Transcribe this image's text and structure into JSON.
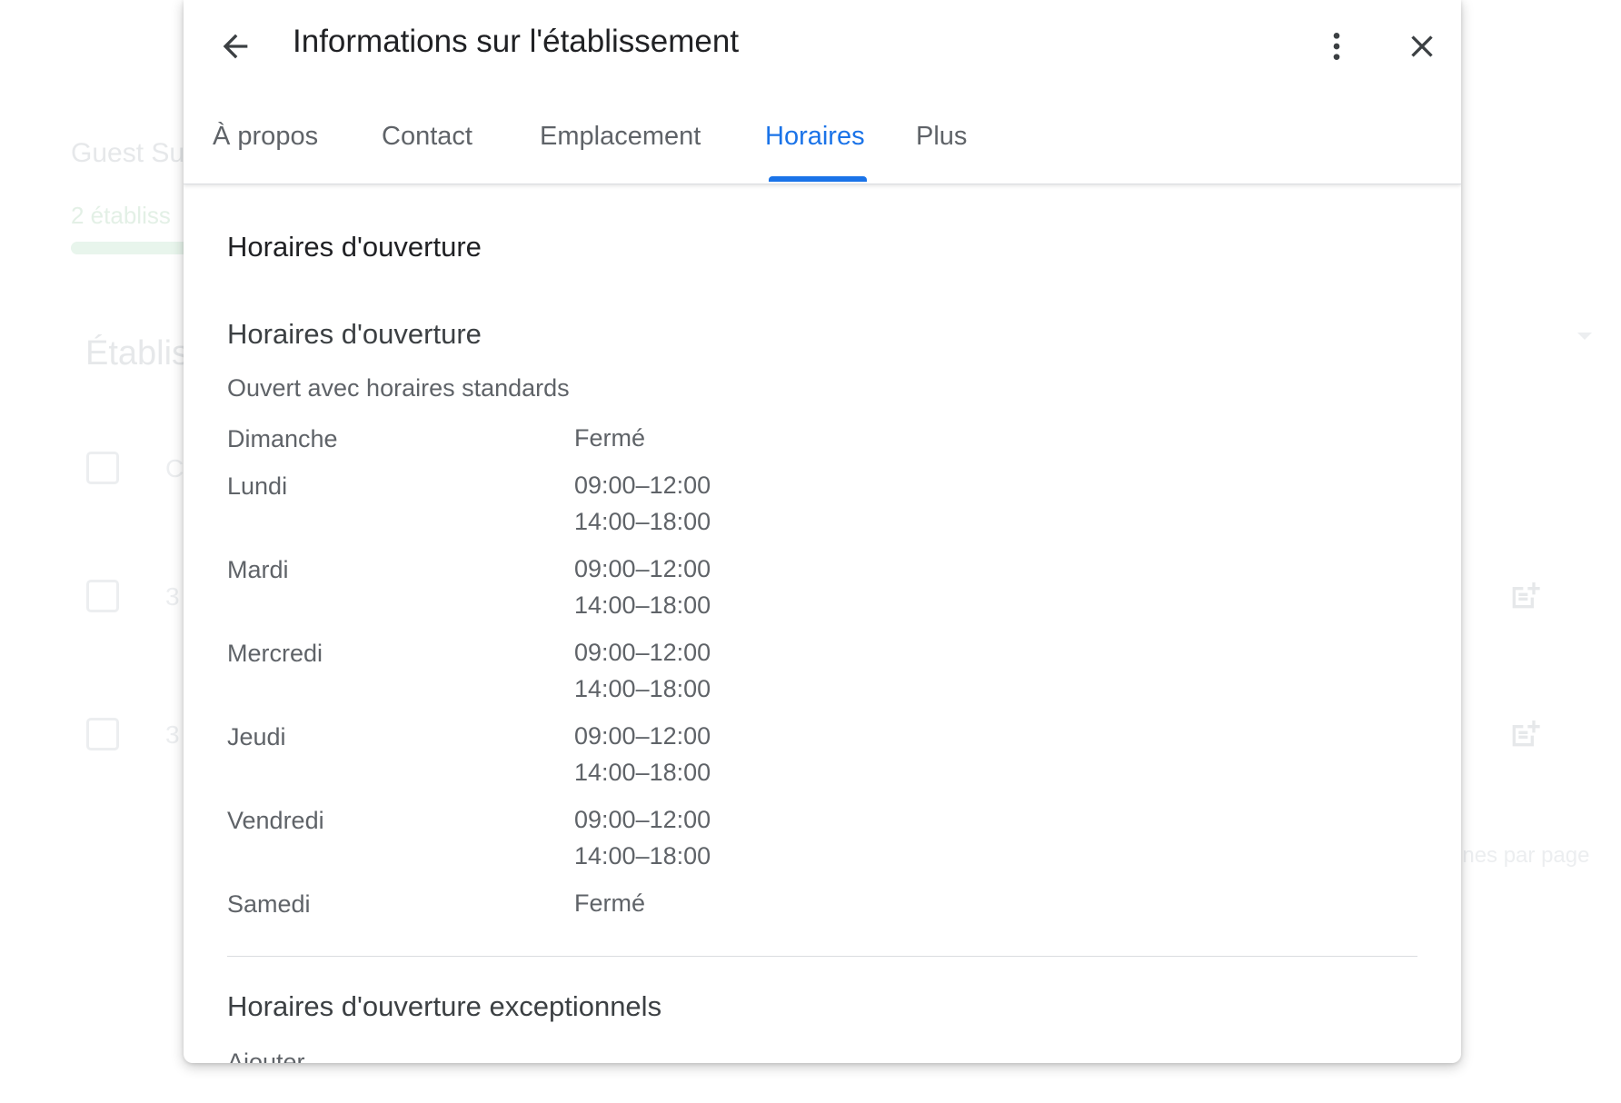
{
  "background": {
    "title": "Guest Su",
    "subtitle": "2 établiss",
    "heading": "Établis",
    "row_texts": [
      "C",
      "3",
      "3"
    ],
    "rows_per_page": "gnes par page"
  },
  "dialog": {
    "title": "Informations sur l'établissement",
    "tabs": [
      {
        "label": "À propos"
      },
      {
        "label": "Contact"
      },
      {
        "label": "Emplacement"
      },
      {
        "label": "Horaires"
      },
      {
        "label": "Plus"
      }
    ],
    "active_tab": "Horaires",
    "accent_color": "#1a73e8"
  },
  "hours": {
    "section_title": "Horaires d'ouverture",
    "subsection_title": "Horaires d'ouverture",
    "status": "Ouvert avec horaires standards",
    "days": [
      {
        "day": "Dimanche",
        "hours": [
          "Fermé"
        ]
      },
      {
        "day": "Lundi",
        "hours": [
          "09:00–12:00",
          "14:00–18:00"
        ]
      },
      {
        "day": "Mardi",
        "hours": [
          "09:00–12:00",
          "14:00–18:00"
        ]
      },
      {
        "day": "Mercredi",
        "hours": [
          "09:00–12:00",
          "14:00–18:00"
        ]
      },
      {
        "day": "Jeudi",
        "hours": [
          "09:00–12:00",
          "14:00–18:00"
        ]
      },
      {
        "day": "Vendredi",
        "hours": [
          "09:00–12:00",
          "14:00–18:00"
        ]
      },
      {
        "day": "Samedi",
        "hours": [
          "Fermé"
        ]
      }
    ],
    "exceptional_title": "Horaires d'ouverture exceptionnels",
    "add_label": "Ajouter"
  }
}
